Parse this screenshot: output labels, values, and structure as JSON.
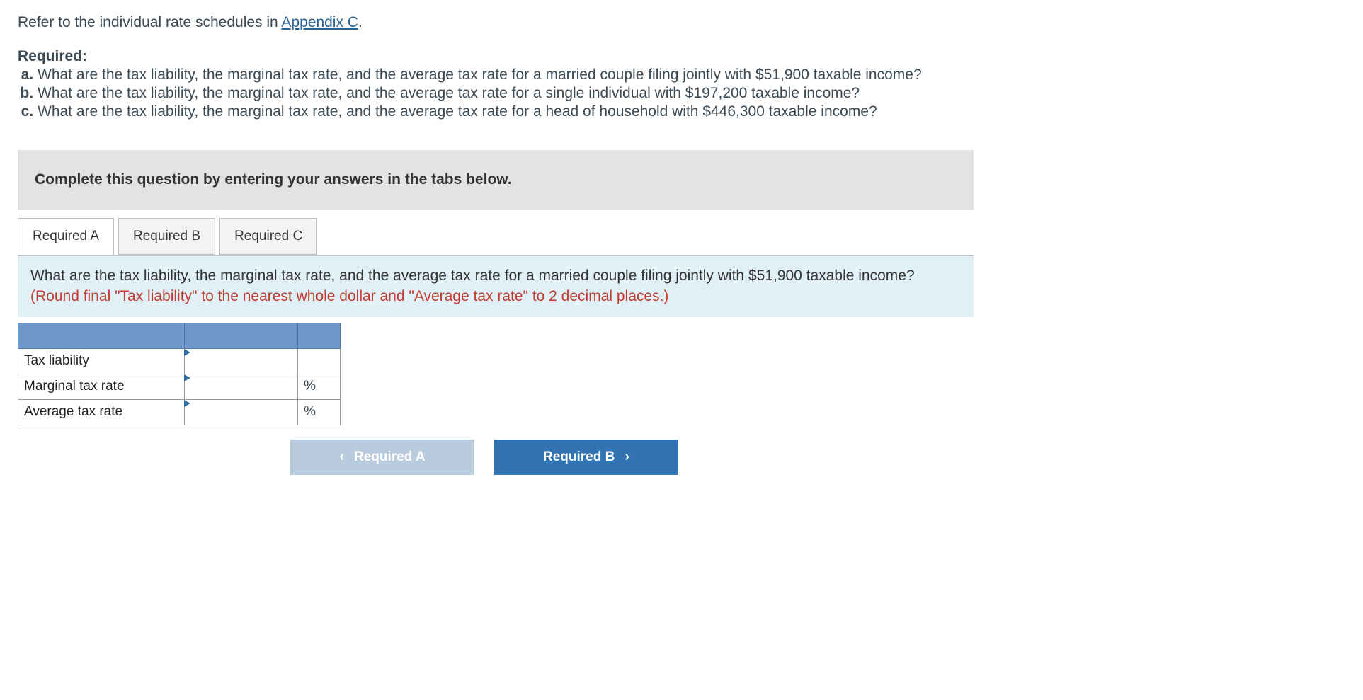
{
  "intro": {
    "prefix": "Refer to the individual rate schedules in ",
    "link_text": "Appendix C",
    "suffix": "."
  },
  "required": {
    "heading": "Required:",
    "items": [
      "What are the tax liability, the marginal tax rate, and the average tax rate for a married couple filing jointly with $51,900 taxable income?",
      "What are the tax liability, the marginal tax rate, and the average tax rate for a single individual with $197,200 taxable income?",
      "What are the tax liability, the marginal tax rate, and the average tax rate for a head of household with $446,300 taxable income?"
    ]
  },
  "instruction": "Complete this question by entering your answers in the tabs below.",
  "tabs": [
    {
      "label": "Required A",
      "active": true
    },
    {
      "label": "Required B",
      "active": false
    },
    {
      "label": "Required C",
      "active": false
    }
  ],
  "prompt": {
    "question": "What are the tax liability, the marginal tax rate, and the average tax rate for a married couple filing jointly with $51,900 taxable income? ",
    "hint": "(Round final \"Tax liability\" to the nearest whole dollar and \"Average tax rate\" to 2 decimal places.)"
  },
  "table": {
    "rows": [
      {
        "label": "Tax liability",
        "value": "",
        "unit": ""
      },
      {
        "label": "Marginal tax rate",
        "value": "",
        "unit": "%"
      },
      {
        "label": "Average tax rate",
        "value": "",
        "unit": "%"
      }
    ]
  },
  "nav": {
    "prev": "Required A",
    "next": "Required B"
  }
}
